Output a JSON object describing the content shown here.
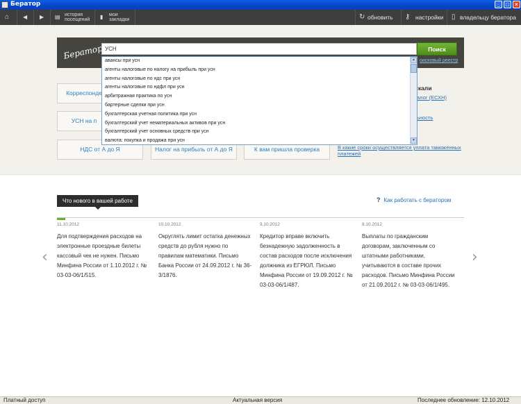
{
  "window": {
    "title": "Бератор"
  },
  "toolbar": {
    "history": {
      "line1": "история",
      "line2": "посещений"
    },
    "bookmarks": {
      "line1": "мои",
      "line2": "закладки"
    },
    "refresh": "обновить",
    "settings": "настройки",
    "owner": "владельцу бератора"
  },
  "search": {
    "logo": "Бератор",
    "value": "УСН",
    "button": "Поиск",
    "registry_link": "оисковый реестр"
  },
  "suggestions": [
    "авансы при усн",
    "агенты налоговые по налогу на прибыль при усн",
    "агенты налоговые по ндс при усн",
    "агенты налоговые по ндфл при усн",
    "арбитражная практика по усн",
    "бартерные сделки при усн",
    "бухгалтерская учетная политика при усн",
    "бухгалтерский учет нематериальных активов при усн",
    "бухгалтерский учет основных средств при усн",
    "валюта: покупка и продажа при усн"
  ],
  "tiles": {
    "t1": "Корреспонде",
    "t2": "УСН на п",
    "t3": "НДС от А до Я",
    "t4": "Налог на прибыль от А до Я",
    "t5": "К вам пришла проверка"
  },
  "side": {
    "title": "искали",
    "link1": "алог (ЕСХН)",
    "link2": "ьность",
    "link3_line1": "В какие сроки осуществляется уплата таможенных",
    "link3_line2": "платежей"
  },
  "news": {
    "tab_label": "Что нового в вашей работе",
    "howto": "Как работать с бератором",
    "howto_icon": "?",
    "progress": 0.02,
    "items": [
      {
        "date": "11.10.2012",
        "text": "Для подтверждения расходов на электронные проездные билеты кассовый чек не нужен. Письмо Минфина России от 1.10.2012 г. № 03-03-06/1/515."
      },
      {
        "date": "10.10.2012",
        "text": "Округлять лимит остатка денежных средств до рубля нужно по правилам математики. Письмо Банка России от 24.09.2012 г. № 36-3/1876."
      },
      {
        "date": "9.10.2012",
        "text": "Кредитор вправе включить безнадежную задолженность в состав расходов после исключения должника из ЕГРЮЛ. Письмо Минфина России от 19.09.2012 г. № 03-03-06/1/487."
      },
      {
        "date": "8.10.2012",
        "text": "Выплаты по гражданским договорам, заключенным со штатными работниками, учитываются в составе прочих расходов. Письмо Минфина России от 21.09.2012 г. № 03-03-06/1/495."
      }
    ]
  },
  "status": {
    "left": "Платный доступ",
    "center": "Актуальная версия",
    "right": "Последнее обновление: 12.10.2012"
  },
  "colors": {
    "accent_green": "#6cb12b",
    "link_blue": "#2a6fb3",
    "toolbar_bg": "#3e3e3e",
    "upper_bg": "#f3f1ec"
  }
}
